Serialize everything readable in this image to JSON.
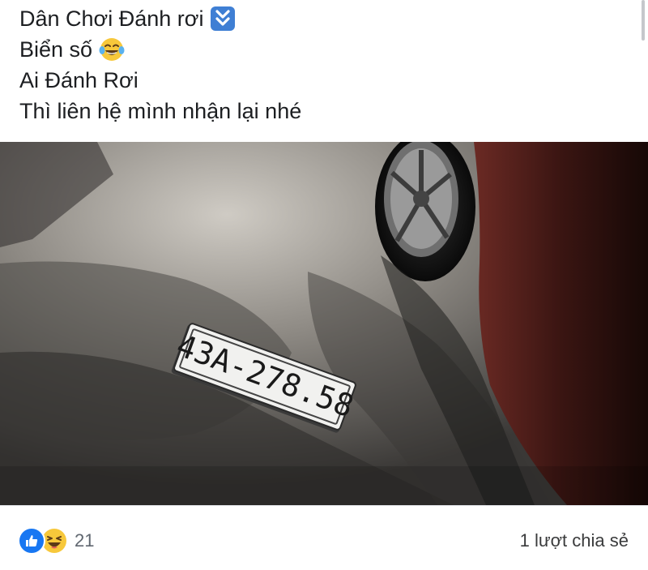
{
  "post": {
    "lines": [
      "Dân Chơi Đánh rơi",
      "Biển số",
      "Ai Đánh Rơi",
      "Thì liên hệ mình nhận lại nhé"
    ],
    "icons": {
      "line1": "down-arrows-emoji-icon",
      "line2": "laughing-tears-emoji-icon"
    }
  },
  "photo": {
    "plate_text": "43A-278.58"
  },
  "footer": {
    "reaction_icons": [
      "like-reaction-icon",
      "haha-reaction-icon"
    ],
    "reaction_count": "21",
    "shares_label": "1 lượt chia sẻ"
  },
  "colors": {
    "like_blue": "#1877f2",
    "emoji_yellow": "#f7c83b",
    "text": "#1c1e21",
    "meta_text": "#606770"
  }
}
